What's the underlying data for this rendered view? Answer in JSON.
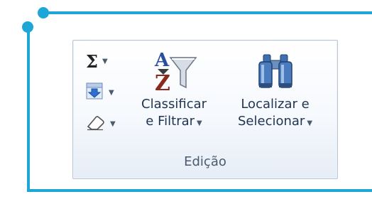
{
  "ribbon": {
    "group_label": "Edição",
    "autosum": {
      "icon": "sigma-icon",
      "symbol": "Σ"
    },
    "fill": {
      "icon": "fill-down-icon"
    },
    "clear": {
      "icon": "eraser-icon"
    },
    "sort_filter": {
      "icon": "sort-filter-icon",
      "line1": "Classificar",
      "line2": "e Filtrar"
    },
    "find_select": {
      "icon": "binoculars-icon",
      "line1": "Localizar e",
      "line2": "Selecionar"
    }
  },
  "colors": {
    "frame": "#1ea7d6"
  }
}
